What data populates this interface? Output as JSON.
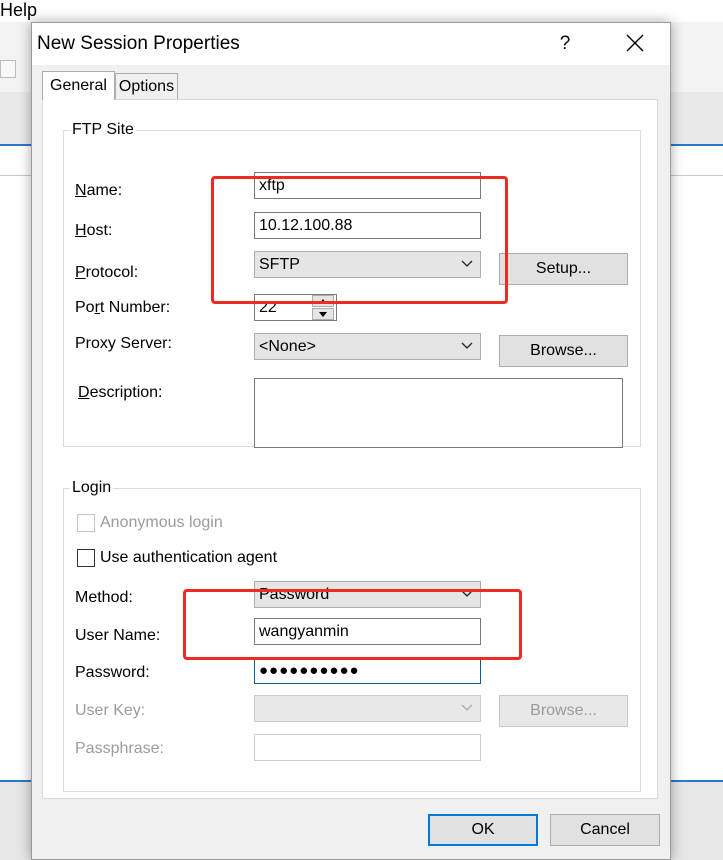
{
  "background_app": {
    "menu_help": "Help"
  },
  "dialog": {
    "title": "New Session Properties",
    "help_glyph": "?",
    "tabs": [
      {
        "label": "General"
      },
      {
        "label": "Options"
      }
    ],
    "ftp_site": {
      "group_label": "FTP Site",
      "name": {
        "label": "Name:",
        "underline_char": "N",
        "value": "xftp"
      },
      "host": {
        "label": "Host:",
        "underline_char": "H",
        "value": "10.12.100.88"
      },
      "protocol": {
        "label": "Protocol:",
        "underline_char": "P",
        "value": "SFTP",
        "setup_button": "Setup..."
      },
      "port": {
        "label": "Port Number:",
        "underline_char": "r",
        "value": "22"
      },
      "proxy": {
        "label": "Proxy Server:",
        "value": "<None>",
        "browse_button": "Browse..."
      },
      "description": {
        "label": "Description:",
        "underline_char": "D",
        "value": ""
      }
    },
    "login": {
      "group_label": "Login",
      "anonymous_login": {
        "label": "Anonymous login",
        "checked": false,
        "enabled": false
      },
      "use_auth_agent": {
        "label": "Use authentication agent",
        "checked": false
      },
      "method": {
        "label": "Method:",
        "value": "Password"
      },
      "user_name": {
        "label": "User Name:",
        "value": "wangyanmin"
      },
      "password": {
        "label": "Password:",
        "value": "●●●●●●●●●●"
      },
      "user_key": {
        "label": "User Key:",
        "value": "",
        "browse_button": "Browse..."
      },
      "passphrase": {
        "label": "Passphrase:",
        "value": ""
      }
    },
    "buttons": {
      "ok": "OK",
      "cancel": "Cancel"
    }
  },
  "colors": {
    "highlight_annotation": "#ee2a24",
    "default_button_border": "#0078d7",
    "background_accent": "#2b78c8"
  }
}
